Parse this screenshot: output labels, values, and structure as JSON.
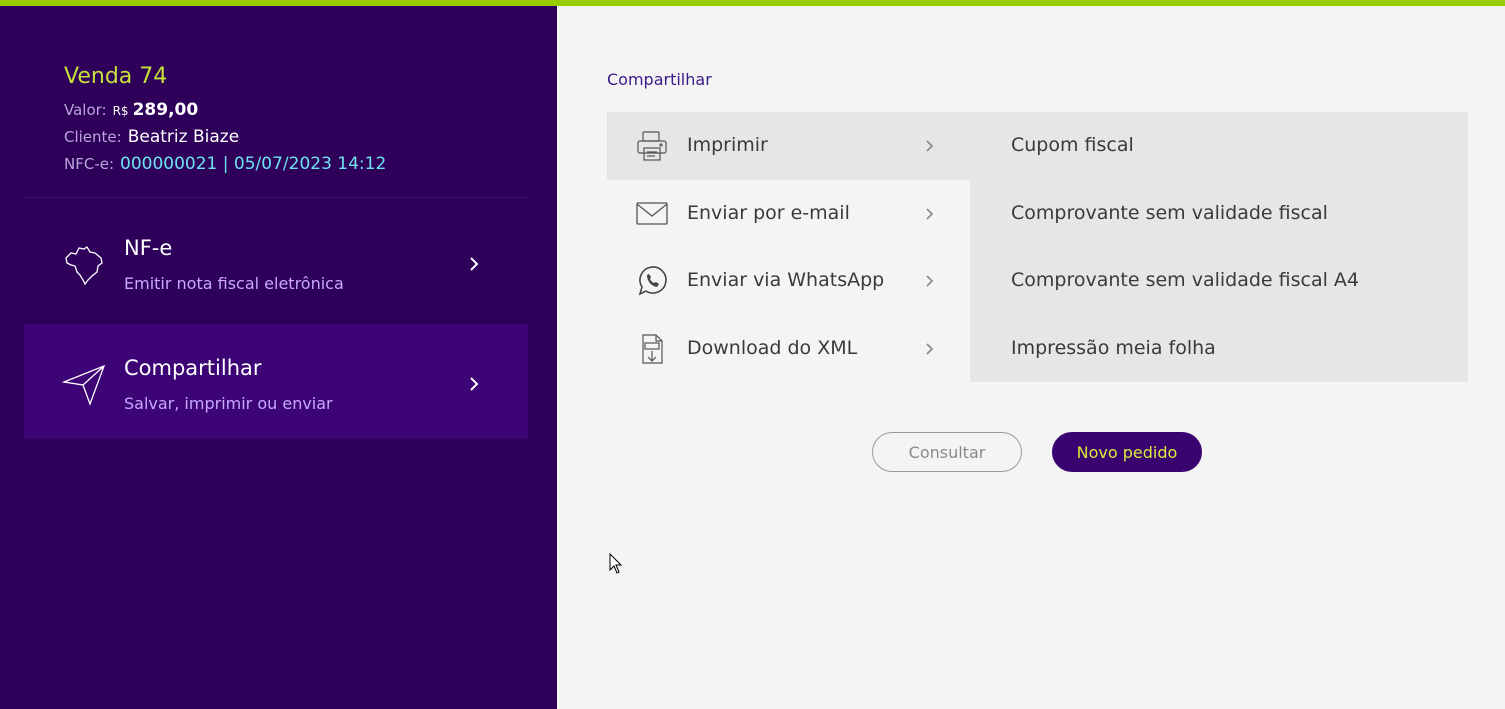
{
  "colors": {
    "accent_green": "#99cc00",
    "sidebar_bg": "#2e005a",
    "active_bg": "#3d0476",
    "primary": "#3a0470"
  },
  "sale": {
    "title": "Venda 74",
    "valor_label": "Valor:",
    "currency": "R$",
    "amount": "289,00",
    "cliente_label": "Cliente:",
    "cliente": "Beatriz Biaze",
    "nfce_label": "NFC-e:",
    "nfce": "000000021 | 05/07/2023 14:12"
  },
  "menu": [
    {
      "title": "NF-e",
      "subtitle": "Emitir nota fiscal eletrônica",
      "icon": "brazil-map-icon"
    },
    {
      "title": "Compartilhar",
      "subtitle": "Salvar, imprimir ou enviar",
      "icon": "paper-plane-icon",
      "active": true
    }
  ],
  "share": {
    "section_label": "Compartilhar",
    "options": [
      {
        "label": "Imprimir",
        "icon": "printer-icon"
      },
      {
        "label": "Enviar por e-mail",
        "icon": "envelope-icon"
      },
      {
        "label": "Enviar via WhatsApp",
        "icon": "whatsapp-icon"
      },
      {
        "label": "Download do XML",
        "icon": "xml-download-icon"
      }
    ],
    "print_options": [
      "Cupom fiscal",
      "Comprovante sem validade fiscal",
      "Comprovante sem validade fiscal A4",
      "Impressão meia folha"
    ]
  },
  "actions": {
    "consultar": "Consultar",
    "novo_pedido": "Novo pedido"
  }
}
